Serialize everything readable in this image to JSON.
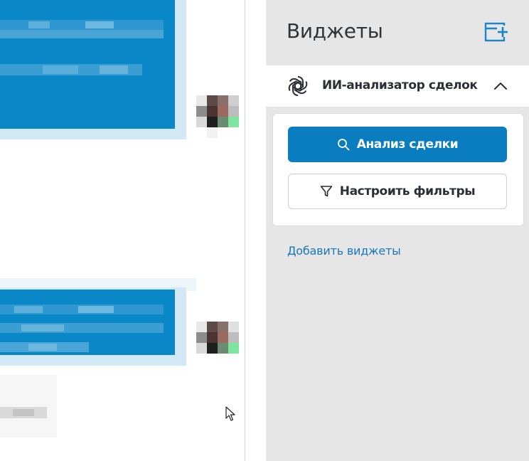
{
  "panel": {
    "title": "Виджеты",
    "add_widget_icon": "add-widget-icon"
  },
  "widget": {
    "name": "ИИ-анализатор сделок",
    "icon": "ai-icon",
    "collapse_icon": "chevron-up-icon",
    "buttons": {
      "analyze": {
        "label": "Анализ сделки",
        "icon": "search-icon"
      },
      "filters": {
        "label": "Настроить фильтры",
        "icon": "filter-icon"
      }
    }
  },
  "add_widgets_link": "Добавить виджеты",
  "colors": {
    "accent": "#0a7cc0",
    "link": "#1a78b8",
    "panel_bg": "#e6e6e6"
  }
}
